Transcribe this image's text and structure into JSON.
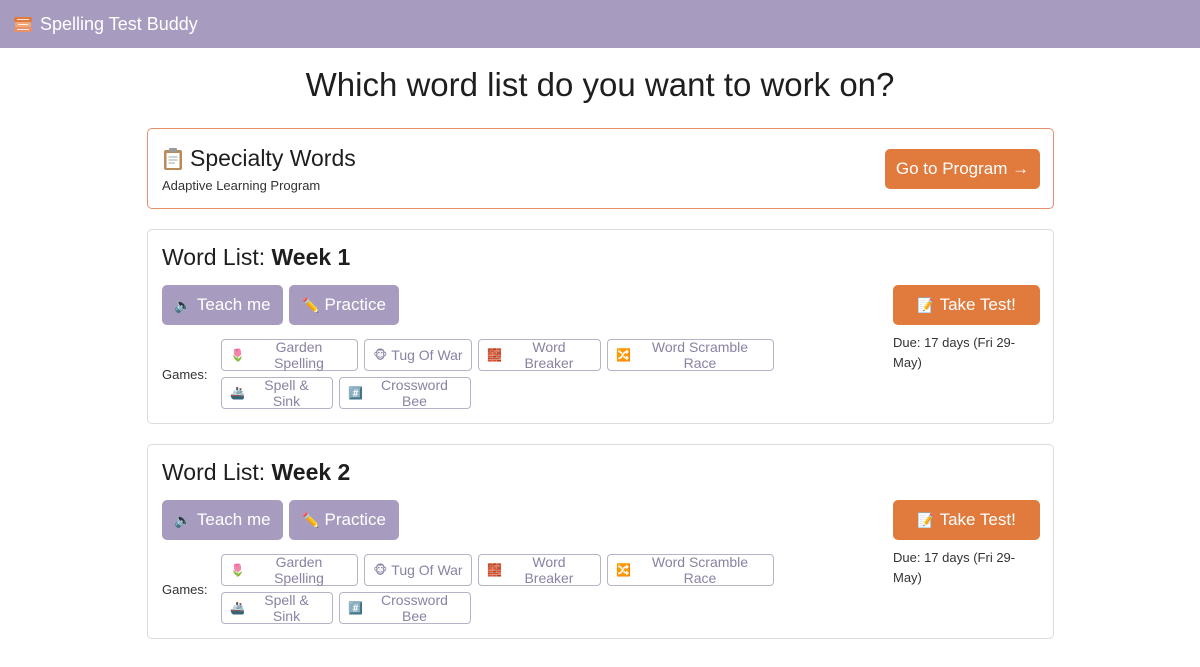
{
  "app": {
    "title": "Spelling Test Buddy",
    "brand_color": "#a79cbf",
    "accent_color": "#e07b3d",
    "icon": "books-stack-icon"
  },
  "heading": "Which word list do you want to work on?",
  "specialty": {
    "emoji": "📋",
    "title": "Specialty Words",
    "subtitle": "Adaptive Learning Program",
    "button_label": "Go to Program →"
  },
  "word_lists": [
    {
      "prefix": "Word List: ",
      "name": "Week 1",
      "teach": {
        "emoji": "🔈",
        "label": "Teach me"
      },
      "practice": {
        "emoji": "✏️",
        "label": "Practice"
      },
      "test": {
        "emoji": "📝",
        "label": "Take Test!"
      },
      "due": "Due: 17 days (Fri 29-May)",
      "games_label": "Games:",
      "games": [
        {
          "emoji": "🌷",
          "label": "Garden Spelling"
        },
        {
          "emoji": "🐵",
          "label": "Tug Of War"
        },
        {
          "emoji": "🧱",
          "label": "Word Breaker"
        },
        {
          "emoji": "🔀",
          "label": "Word Scramble Race"
        },
        {
          "emoji": "🚢",
          "label": "Spell & Sink"
        },
        {
          "emoji": "#️⃣",
          "label": "Crossword Bee"
        }
      ]
    },
    {
      "prefix": "Word List: ",
      "name": "Week 2",
      "teach": {
        "emoji": "🔈",
        "label": "Teach me"
      },
      "practice": {
        "emoji": "✏️",
        "label": "Practice"
      },
      "test": {
        "emoji": "📝",
        "label": "Take Test!"
      },
      "due": "Due: 17 days (Fri 29-May)",
      "games_label": "Games:",
      "games": [
        {
          "emoji": "🌷",
          "label": "Garden Spelling"
        },
        {
          "emoji": "🐵",
          "label": "Tug Of War"
        },
        {
          "emoji": "🧱",
          "label": "Word Breaker"
        },
        {
          "emoji": "🔀",
          "label": "Word Scramble Race"
        },
        {
          "emoji": "🚢",
          "label": "Spell & Sink"
        },
        {
          "emoji": "#️⃣",
          "label": "Crossword Bee"
        }
      ]
    }
  ]
}
